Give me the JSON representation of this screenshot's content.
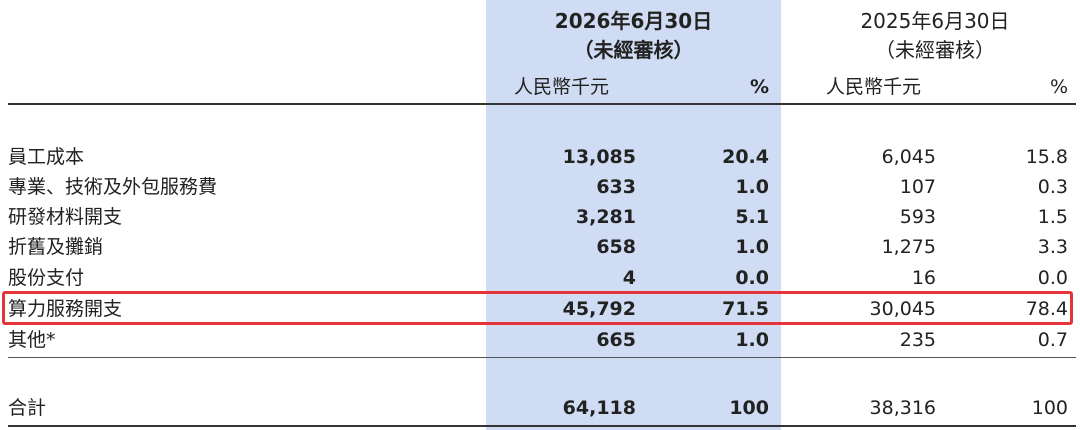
{
  "header": {
    "current": {
      "date": "2026年6月30日",
      "audit": "（未經審核）",
      "unit": "人民幣千元",
      "pct": "%"
    },
    "prior": {
      "date": "2025年6月30日",
      "audit": "（未經審核）",
      "unit": "人民幣千元",
      "pct": "%"
    }
  },
  "rows": [
    {
      "label": "員工成本",
      "cur_amt": "13,085",
      "cur_pct": "20.4",
      "pri_amt": "6,045",
      "pri_pct": "15.8"
    },
    {
      "label": "專業、技術及外包服務費",
      "cur_amt": "633",
      "cur_pct": "1.0",
      "pri_amt": "107",
      "pri_pct": "0.3"
    },
    {
      "label": "研發材料開支",
      "cur_amt": "3,281",
      "cur_pct": "5.1",
      "pri_amt": "593",
      "pri_pct": "1.5"
    },
    {
      "label": "折舊及攤銷",
      "cur_amt": "658",
      "cur_pct": "1.0",
      "pri_amt": "1,275",
      "pri_pct": "3.3"
    },
    {
      "label": "股份支付",
      "cur_amt": "4",
      "cur_pct": "0.0",
      "pri_amt": "16",
      "pri_pct": "0.0"
    },
    {
      "label": "算力服務開支",
      "cur_amt": "45,792",
      "cur_pct": "71.5",
      "pri_amt": "30,045",
      "pri_pct": "78.4"
    },
    {
      "label": "其他*",
      "cur_amt": "665",
      "cur_pct": "1.0",
      "pri_amt": "235",
      "pri_pct": "0.7"
    }
  ],
  "total": {
    "label": "合計",
    "cur_amt": "64,118",
    "cur_pct": "100",
    "pri_amt": "38,316",
    "pri_pct": "100"
  },
  "colors": {
    "highlight_column": "#cfdcf3",
    "row_highlight_border": "#e5333a"
  }
}
